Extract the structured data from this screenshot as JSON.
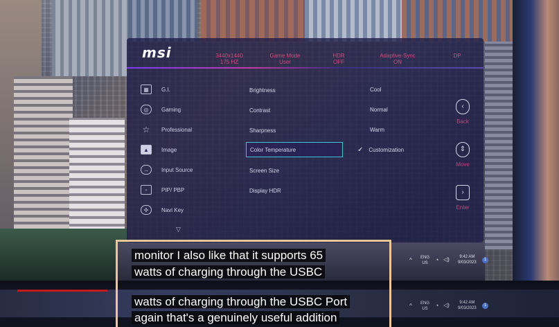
{
  "osd": {
    "logo": "msi",
    "header": [
      {
        "label": "3440x1440",
        "value": "175 HZ"
      },
      {
        "label": "Game Mode",
        "value": "User"
      },
      {
        "label": "HDR",
        "value": "OFF"
      },
      {
        "label": "Adaptive-Sync",
        "value": "ON"
      },
      {
        "label": "DP",
        "value": ""
      }
    ],
    "left_menu": [
      "G.I.",
      "Gaming",
      "Professional",
      "Image",
      "Input Source",
      "PIP/ PBP",
      "Navi Key"
    ],
    "mid_menu": [
      "Brightness",
      "Contrast",
      "Sharpness",
      "Color Temperature",
      "Screen Size",
      "Display HDR"
    ],
    "right_menu": [
      "Cool",
      "Normal",
      "Warm",
      "Customization"
    ],
    "nav": {
      "back": "Back",
      "move": "Move",
      "enter": "Enter"
    }
  },
  "taskbar": {
    "lang_top": "ENG",
    "lang_bottom": "US",
    "time": "9:42 AM",
    "date": "9/03/2023"
  },
  "captions": {
    "line1": "monitor I also like that it supports 65",
    "line2": "watts of charging through the USBC",
    "line3": "watts of charging through the USBC Port",
    "line4": "again that's a genuinely useful addition"
  },
  "colors": {
    "accent_pink": "#c2447a",
    "selection_cyan": "#3fc6d6",
    "caption_border": "#e8c89a"
  },
  "icons": [
    "image-icon",
    "gamepad-icon",
    "star-icon",
    "picture-icon",
    "input-source-icon",
    "pip-icon",
    "navi-key-icon",
    "chevron-down-icon",
    "check-icon",
    "back-icon",
    "move-icon",
    "enter-icon",
    "wifi-icon",
    "volume-icon",
    "notification-icon"
  ]
}
